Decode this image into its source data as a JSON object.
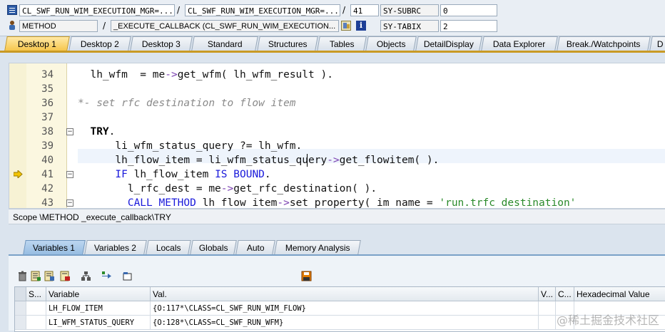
{
  "info": {
    "row1": {
      "program": "CL_SWF_RUN_WIM_EXECUTION_MGR=...",
      "include": "CL_SWF_RUN_WIM_EXECUTION_MGR=...",
      "line": "41",
      "sysvar": "SY-SUBRC",
      "sysval": "0",
      "separator": "/"
    },
    "row2": {
      "event_type": "METHOD",
      "event": "_EXECUTE_CALLBACK (CL_SWF_RUN_WIM_EXECUTION...",
      "sysvar": "SY-TABIX",
      "sysval": "2",
      "separator": "/"
    }
  },
  "main_tabs": [
    {
      "label": "Desktop 1",
      "active": true
    },
    {
      "label": "Desktop 2"
    },
    {
      "label": "Desktop 3"
    },
    {
      "label": "Standard"
    },
    {
      "label": "Structures"
    },
    {
      "label": "Tables"
    },
    {
      "label": "Objects"
    },
    {
      "label": "DetailDisplay"
    },
    {
      "label": "Data Explorer"
    },
    {
      "label": "Break./Watchpoints"
    },
    {
      "label": "D"
    }
  ],
  "code": {
    "line_numbers": [
      "34",
      "35",
      "36",
      "37",
      "38",
      "39",
      "40",
      "41",
      "42",
      "43"
    ],
    "current_line": "41",
    "lines": [
      "  lh_wfm  = me->get_wfm( lh_wfm_result ).",
      "",
      "*- set rfc destination to flow item",
      "",
      "  TRY.",
      "      li_wfm_status_query ?= lh_wfm.",
      "      lh_flow_item = li_wfm_status_query->get_flowitem( ).",
      "      IF lh_flow_item IS BOUND.",
      "        l_rfc_dest = me->get_rfc_destination( ).",
      "        CALL METHOD lh_flow_item->set_property( im_name = 'run.trfc_destination'"
    ]
  },
  "scope": {
    "text": "Scope \\METHOD _execute_callback\\TRY"
  },
  "var_tabs": [
    {
      "label": "Variables 1",
      "active": true
    },
    {
      "label": "Variables 2"
    },
    {
      "label": "Locals"
    },
    {
      "label": "Globals"
    },
    {
      "label": "Auto"
    },
    {
      "label": "Memory Analysis"
    }
  ],
  "toolbar": {
    "icons": [
      "delete-icon",
      "detail-icon",
      "new-row-icon",
      "clear-icon",
      "tree-icon",
      "navigate-icon",
      "tag-icon",
      "save-icon"
    ]
  },
  "table": {
    "headers": [
      "S...",
      "Variable",
      "Val.",
      "V...",
      "C...",
      "Hexadecimal Value"
    ],
    "rows": [
      {
        "variable": "LH_FLOW_ITEM",
        "value": "{O:117*\\CLASS=CL_SWF_RUN_WIM_FLOW}"
      },
      {
        "variable": "LI_WFM_STATUS_QUERY",
        "value": "{O:128*\\CLASS=CL_SWF_RUN_WFM}"
      }
    ]
  },
  "watermark": "@稀土掘金技术社区",
  "colors": {
    "active_tab": "#f6c64d",
    "var_active_tab": "#97bde2",
    "keyword": "#1a1adb",
    "string": "#2a8a2a",
    "comment": "#8a8a8a"
  }
}
